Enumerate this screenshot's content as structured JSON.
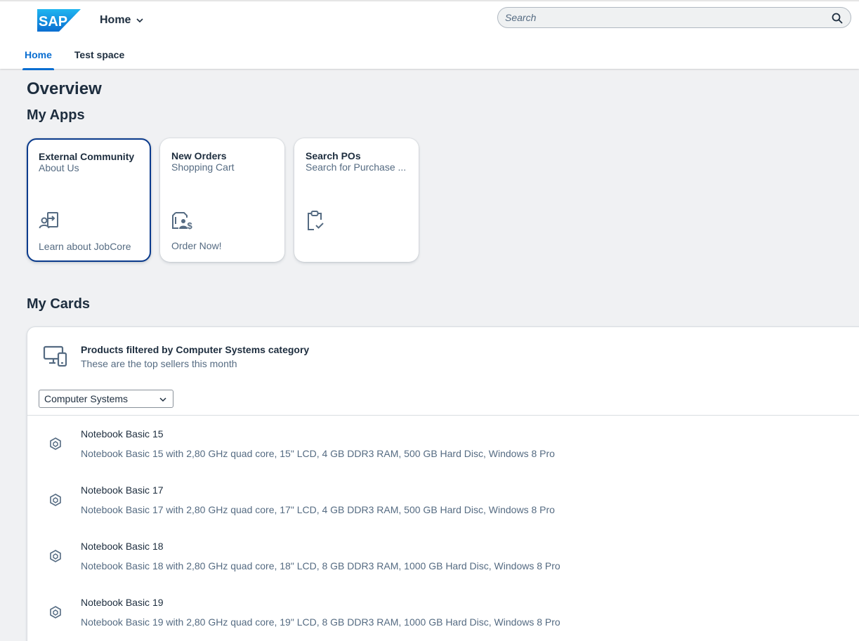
{
  "shell": {
    "logo_text": "SAP",
    "home_label": "Home",
    "search_placeholder": "Search"
  },
  "tabs": [
    {
      "label": "Home",
      "active": true
    },
    {
      "label": "Test space",
      "active": false
    }
  ],
  "overview": {
    "title": "Overview",
    "apps_heading": "My Apps",
    "cards_heading": "My Cards"
  },
  "apps": [
    {
      "title": "External Community",
      "subtitle": "About Us",
      "icon": "person-arrow-icon",
      "footer": "Learn about JobCore"
    },
    {
      "title": "New Orders",
      "subtitle": "Shopping Cart",
      "icon": "document-customer-money-icon",
      "footer": "Order Now!"
    },
    {
      "title": "Search POs",
      "subtitle": "Search for Purchase ...",
      "icon": "clipboard-check-icon",
      "footer": ""
    }
  ],
  "card": {
    "icon": "desktop-mobile-icon",
    "title": "Products filtered by Computer Systems category",
    "subtitle": "These are the top sellers this month",
    "filter_value": "Computer Systems",
    "items": [
      {
        "title": "Notebook Basic 15",
        "description": "Notebook Basic 15 with 2,80 GHz quad core, 15\" LCD, 4 GB DDR3 RAM, 500 GB Hard Disc, Windows 8 Pro"
      },
      {
        "title": "Notebook Basic 17",
        "description": "Notebook Basic 17 with 2,80 GHz quad core, 17\" LCD, 4 GB DDR3 RAM, 500 GB Hard Disc, Windows 8 Pro"
      },
      {
        "title": "Notebook Basic 18",
        "description": "Notebook Basic 18 with 2,80 GHz quad core, 18\" LCD, 8 GB DDR3 RAM, 1000 GB Hard Disc, Windows 8 Pro"
      },
      {
        "title": "Notebook Basic 19",
        "description": "Notebook Basic 19 with 2,80 GHz quad core, 19\" LCD, 8 GB DDR3 RAM, 1000 GB Hard Disc, Windows 8 Pro"
      }
    ]
  },
  "colors": {
    "accent": "#0a6ed1",
    "focus_border": "#0a3a8c",
    "text": "#1d2d3e",
    "secondary_text": "#556b82",
    "background": "#f0f1f3"
  }
}
